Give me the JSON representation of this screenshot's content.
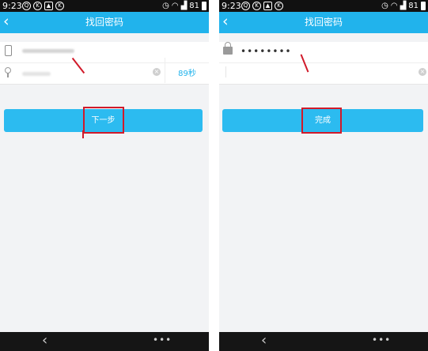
{
  "status_bar": {
    "time": "9:23",
    "battery": "81"
  },
  "screens": [
    {
      "title": "找回密码",
      "countdown": "89秒",
      "submit_label": "下一步"
    },
    {
      "title": "找回密码",
      "password_value": "••••••••",
      "submit_label": "完成"
    }
  ],
  "icons": {
    "back": "chevron-left-icon",
    "phone": "phone-icon",
    "key": "key-icon",
    "lock": "lock-icon",
    "clear": "clear-icon",
    "nav_back": "back-icon",
    "nav_menu": "more-icon",
    "status": [
      "qq-icon",
      "k-icon",
      "image-icon",
      "k-icon",
      "alarm-icon",
      "wifi-icon",
      "signal-icon",
      "battery-icon"
    ]
  },
  "colors": {
    "accent": "#21b3ec",
    "button": "#2cbbf0",
    "annotation": "#d11a2a",
    "status_bar": "#111111",
    "nav_bar": "#151515",
    "background": "#f2f3f5"
  }
}
